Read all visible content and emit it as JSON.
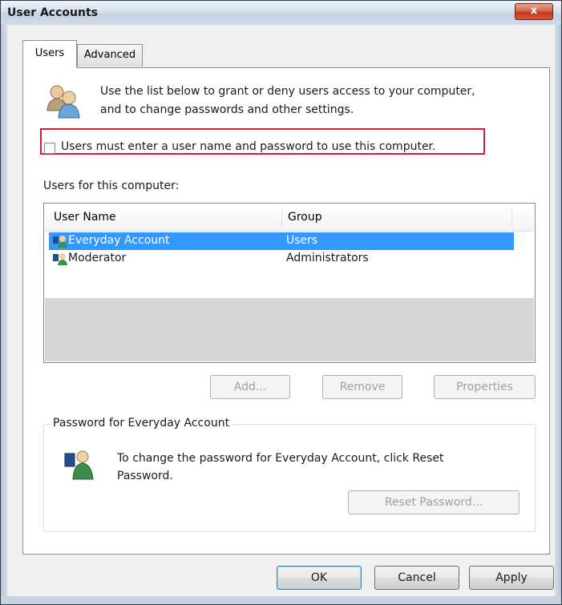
{
  "window": {
    "title": "User Accounts",
    "close_glyph": "x"
  },
  "tabs": [
    {
      "label": "Users",
      "active": true
    },
    {
      "label": "Advanced",
      "active": false
    }
  ],
  "intro_text_line1": "Use the list below to grant or deny users access to your computer,",
  "intro_text_line2": "and to change passwords and other settings.",
  "require_login_checkbox": {
    "label": "Users must enter a user name and password to use this computer.",
    "checked": false
  },
  "users_label": "Users for this computer:",
  "users_table": {
    "columns": [
      "User Name",
      "Group"
    ],
    "rows": [
      {
        "name": "Everyday Account",
        "group": "Users",
        "selected": true
      },
      {
        "name": "Moderator",
        "group": "Administrators",
        "selected": false
      }
    ]
  },
  "list_buttons": {
    "add": "Add...",
    "remove": "Remove",
    "properties": "Properties"
  },
  "password_group": {
    "title": "Password for Everyday Account",
    "text_line1": "To change the password for Everyday Account, click Reset",
    "text_line2": "Password.",
    "reset_button": "Reset Password..."
  },
  "dialog_buttons": {
    "ok": "OK",
    "cancel": "Cancel",
    "apply": "Apply"
  },
  "colors": {
    "selection": "#3399ff",
    "highlight_box": "#cc2233",
    "close_button": "#c2391d"
  },
  "icons": [
    "users-icon",
    "user-icon",
    "user-key-icon",
    "close-icon"
  ]
}
